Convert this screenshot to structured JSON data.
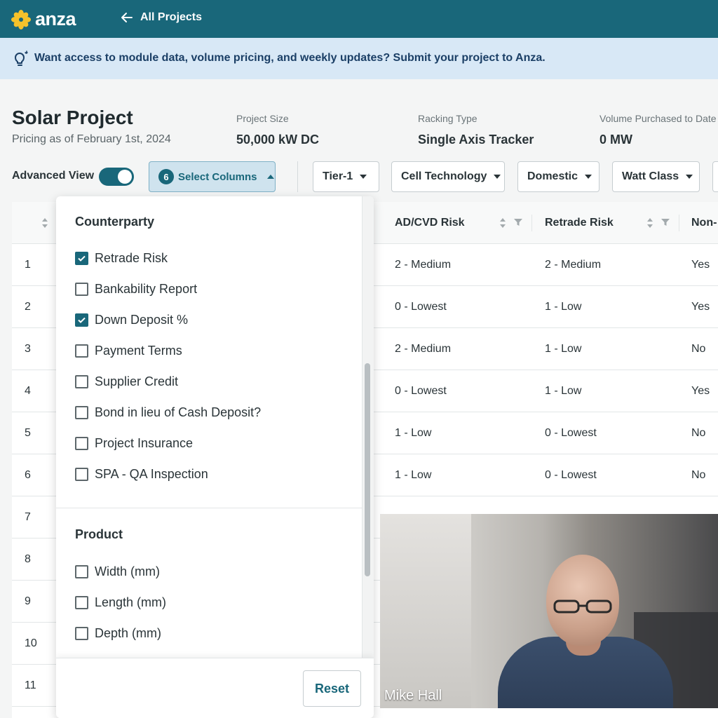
{
  "app": {
    "name": "anza",
    "brand_color": "#19677a"
  },
  "nav": {
    "back_label": "All Projects"
  },
  "banner": {
    "text": "Want access to module data, volume pricing, and weekly updates? Submit your project to Anza."
  },
  "project": {
    "title": "Solar Project",
    "subtitle": "Pricing as of February 1st, 2024",
    "meta": [
      {
        "label": "Project Size",
        "value": "50,000 kW DC"
      },
      {
        "label": "Racking Type",
        "value": "Single Axis Tracker"
      },
      {
        "label": "Volume Purchased to Date",
        "value": "0 MW"
      }
    ]
  },
  "toolbar": {
    "advanced_view_label": "Advanced View",
    "advanced_view_on": true,
    "select_columns_label": "Select Columns",
    "selected_count": "6",
    "filters": [
      "Tier-1",
      "Cell Technology",
      "Domestic",
      "Watt Class"
    ]
  },
  "table": {
    "columns": [
      "AD/CVD Risk",
      "Retrade Risk",
      "Non-"
    ],
    "rows": [
      {
        "n": "1",
        "adcvd": "2 - Medium",
        "retrade": "2 - Medium",
        "non": "Yes"
      },
      {
        "n": "2",
        "adcvd": "0 - Lowest",
        "retrade": "1 - Low",
        "non": "Yes"
      },
      {
        "n": "3",
        "adcvd": "2 - Medium",
        "retrade": "1 - Low",
        "non": "No"
      },
      {
        "n": "4",
        "adcvd": "0 - Lowest",
        "retrade": "1 - Low",
        "non": "Yes"
      },
      {
        "n": "5",
        "adcvd": "1 - Low",
        "retrade": "0 - Lowest",
        "non": "No"
      },
      {
        "n": "6",
        "adcvd": "1 - Low",
        "retrade": "0 - Lowest",
        "non": "No"
      },
      {
        "n": "7"
      },
      {
        "n": "8"
      },
      {
        "n": "9"
      },
      {
        "n": "10"
      },
      {
        "n": "11"
      }
    ]
  },
  "columns_panel": {
    "sections": [
      {
        "title": "Counterparty",
        "options": [
          {
            "label": "Retrade Risk",
            "checked": true
          },
          {
            "label": "Bankability Report",
            "checked": false
          },
          {
            "label": "Down Deposit %",
            "checked": true
          },
          {
            "label": "Payment Terms",
            "checked": false
          },
          {
            "label": "Supplier Credit",
            "checked": false
          },
          {
            "label": "Bond in lieu of Cash Deposit?",
            "checked": false
          },
          {
            "label": "Project Insurance",
            "checked": false
          },
          {
            "label": "SPA - QA Inspection",
            "checked": false
          }
        ]
      },
      {
        "title": "Product",
        "options": [
          {
            "label": "Width (mm)",
            "checked": false
          },
          {
            "label": "Length (mm)",
            "checked": false
          },
          {
            "label": "Depth (mm)",
            "checked": false
          }
        ]
      }
    ],
    "reset_label": "Reset"
  },
  "video": {
    "participant_name": "Mike Hall"
  }
}
